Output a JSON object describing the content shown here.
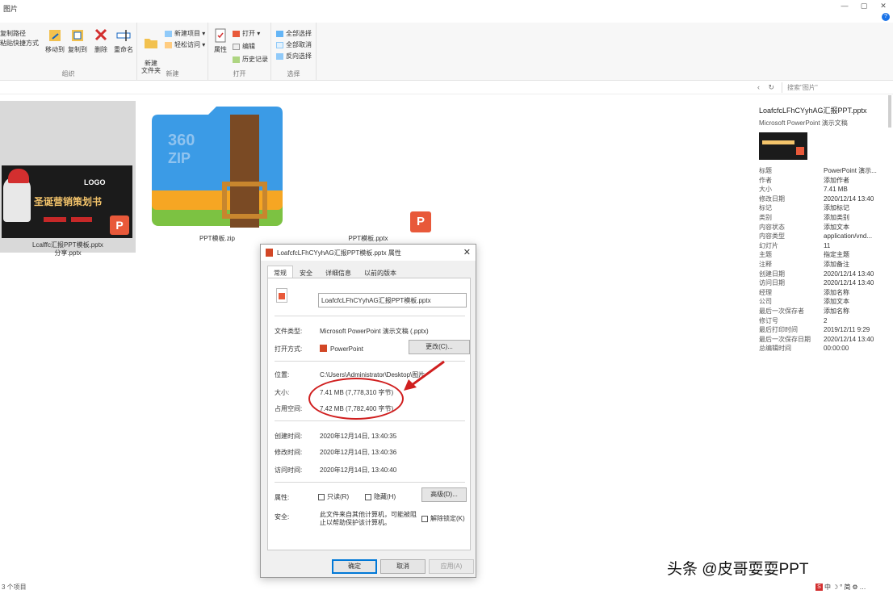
{
  "window": {
    "title": "图片",
    "controls": [
      "—",
      "▢",
      "✕"
    ],
    "help": "?"
  },
  "ribbon": {
    "group1": {
      "label": "组织",
      "items": [
        {
          "label": "复制路径"
        },
        {
          "label": "粘贴快捷方式"
        }
      ],
      "buttons": [
        {
          "label": "移动到"
        },
        {
          "label": "复制到"
        },
        {
          "label": "删除"
        },
        {
          "label": "重命名"
        }
      ]
    },
    "group2": {
      "label": "新建",
      "big": "新建\n文件夹",
      "small": [
        {
          "label": "新建项目 ▾"
        },
        {
          "label": "轻松访问 ▾"
        }
      ]
    },
    "group3": {
      "label": "打开",
      "big": "属性",
      "small": [
        {
          "label": "打开 ▾"
        },
        {
          "label": "编辑"
        },
        {
          "label": "历史记录"
        }
      ]
    },
    "group4": {
      "label": "选择",
      "small": [
        {
          "label": "全部选择"
        },
        {
          "label": "全部取消"
        },
        {
          "label": "反向选择"
        }
      ]
    }
  },
  "address": {
    "nav": "‹ ↻",
    "search_placeholder": "搜索\"图片\""
  },
  "files": [
    {
      "name": "Lcalffc汇报PPT模板.pptx\n分享.pptx",
      "thumb_logo": "LOGO",
      "thumb_title": "圣诞营销策划书",
      "badge": "P"
    },
    {
      "name": "PPT模板.zip",
      "zip_label": "360\nZIP"
    },
    {
      "name": "PPT模板.pptx",
      "badge": "P"
    }
  ],
  "details": {
    "name": "LoafcfcLFhCYyhAG汇报PPT.pptx",
    "type": "Microsoft PowerPoint 演示文稿",
    "props": [
      {
        "k": "标题",
        "v": "PowerPoint 演示..."
      },
      {
        "k": "作者",
        "v": "添加作者"
      },
      {
        "k": "大小",
        "v": "7.41 MB"
      },
      {
        "k": "修改日期",
        "v": "2020/12/14 13:40"
      },
      {
        "k": "标记",
        "v": "添加标记"
      },
      {
        "k": "类别",
        "v": "添加类别"
      },
      {
        "k": "内容状态",
        "v": "添加文本"
      },
      {
        "k": "内容类型",
        "v": "application/vnd..."
      },
      {
        "k": "幻灯片",
        "v": "11"
      },
      {
        "k": "主题",
        "v": "指定主题"
      },
      {
        "k": "注释",
        "v": "添加备注"
      },
      {
        "k": "创建日期",
        "v": "2020/12/14 13:40"
      },
      {
        "k": "访问日期",
        "v": "2020/12/14 13:40"
      },
      {
        "k": "经理",
        "v": "添加名称"
      },
      {
        "k": "公司",
        "v": "添加文本"
      },
      {
        "k": "最后一次保存者",
        "v": "添加名称"
      },
      {
        "k": "修订号",
        "v": "2"
      },
      {
        "k": "最后打印时间",
        "v": "2019/12/11 9:29"
      },
      {
        "k": "最后一次保存日期",
        "v": "2020/12/14 13:40"
      },
      {
        "k": "总编辑时间",
        "v": "00:00:00"
      }
    ]
  },
  "dialog": {
    "title": "LoafcfcLFhCYyhAG汇报PPT模板.pptx 属性",
    "close": "✕",
    "tabs": [
      "常规",
      "安全",
      "详细信息",
      "以前的版本"
    ],
    "filename": "LoafcfcLFhCYyhAG汇报PPT模板.pptx",
    "labels": {
      "file_type": "文件类型:",
      "open_with": "打开方式:",
      "location": "位置:",
      "size": "大小:",
      "size_on_disk": "占用空间:",
      "created": "创建时间:",
      "modified": "修改时间:",
      "accessed": "访问时间:",
      "attributes": "属性:",
      "security": "安全:"
    },
    "values": {
      "file_type": "Microsoft PowerPoint 演示文稿 (.pptx)",
      "open_with": "PowerPoint",
      "location": "C:\\Users\\Administrator\\Desktop\\图片",
      "size": "7.41 MB (7,778,310 字节)",
      "size_on_disk": "7.42 MB (7,782,400 字节)",
      "created": "2020年12月14日, 13:40:35",
      "modified": "2020年12月14日, 13:40:36",
      "accessed": "2020年12月14日, 13:40:40",
      "security_text": "此文件来自其他计算机，可能被阻止以帮助保护该计算机。"
    },
    "buttons": {
      "change": "更改(C)...",
      "advanced": "高级(D)...",
      "ok": "确定",
      "cancel": "取消",
      "apply": "应用(A)"
    },
    "checkboxes": {
      "readonly": "只读(R)",
      "hidden": "隐藏(H)",
      "unblock": "解除锁定(K)"
    }
  },
  "status": {
    "left": "3 个项目"
  },
  "watermark": "头条 @皮哥耍耍PPT",
  "tray": [
    "S",
    "中",
    "☽",
    "°",
    "简",
    "⚙",
    "…"
  ],
  "colors": {
    "annotation": "#d01f1f",
    "ppt_orange": "#e8593a",
    "accent": "#0078d7"
  }
}
